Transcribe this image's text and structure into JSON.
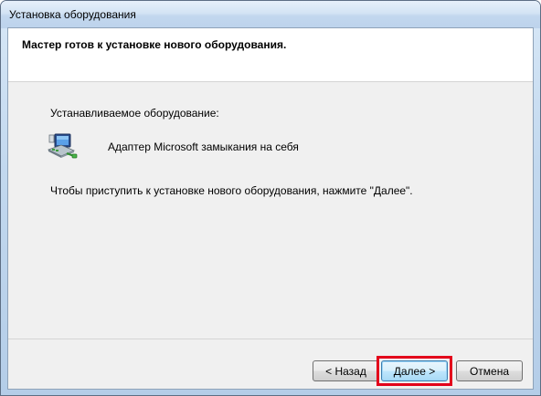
{
  "window": {
    "title": "Установка оборудования"
  },
  "header": {
    "title": "Мастер готов к установке нового оборудования."
  },
  "main": {
    "installing_label": "Устанавливаемое оборудование:",
    "device_name": "Адаптер Microsoft замыкания на себя",
    "instruction": "Чтобы приступить к установке нового оборудования, нажмите \"Далее\".",
    "device_icon": "network-adapter-icon"
  },
  "buttons": {
    "back_label": "< Назад",
    "next_label": "Далее >",
    "cancel_label": "Отмена"
  },
  "colors": {
    "highlight": "#e3001b"
  }
}
